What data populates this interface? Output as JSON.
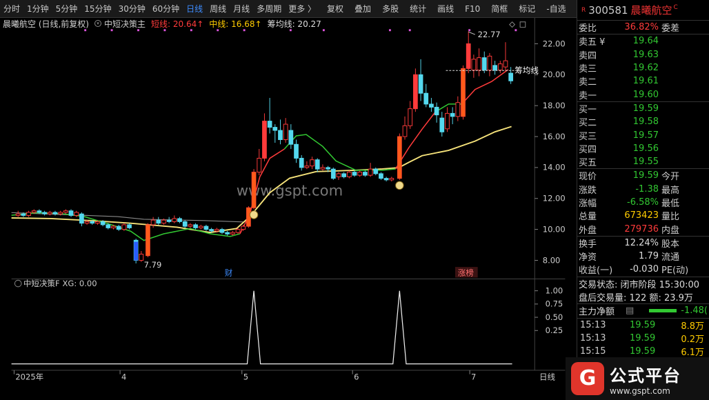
{
  "toolbar": {
    "periods": [
      "分时",
      "1分钟",
      "5分钟",
      "15分钟",
      "30分钟",
      "60分钟",
      "日线",
      "周线",
      "月线",
      "多周期",
      "更多 〉"
    ],
    "active": "日线",
    "tools": [
      "复权",
      "叠加",
      "多股",
      "统计",
      "画线",
      "F10",
      "简框",
      "标记",
      "-自选",
      "返回"
    ]
  },
  "chart_header": {
    "title": "晨曦航空 (日线,前复权)",
    "indicator": "中短决策主",
    "short_label": "短线: 20.64↑",
    "mid_label": "中线: 16.68↑",
    "chip_label": "筹均线: 20.27"
  },
  "annotations": {
    "high_label": "22.77",
    "low_label": "7.79",
    "chip_tag": "筹均线",
    "cai_tag": "财",
    "zhangbang_tag": "涨榜",
    "watermark": "www.gspt.com"
  },
  "price_axis": [
    "22.00",
    "20.00",
    "18.00",
    "16.00",
    "14.00",
    "12.00",
    "10.00",
    "8.00"
  ],
  "sub_header": {
    "name": "中短决策F",
    "xg": "XG: 0.00"
  },
  "sub_axis": [
    "1.00",
    "0.75",
    "0.50",
    "0.25"
  ],
  "date_axis": [
    "2025年",
    "4",
    "5",
    "6",
    "7"
  ],
  "date_axis_right": "日线",
  "quote": {
    "code": "300581",
    "name": "晨曦航空",
    "r_mark": "R",
    "c_mark": "C",
    "weibi": {
      "label": "委比",
      "value": "36.82%",
      "label2": "委差"
    },
    "asks": [
      {
        "label": "卖五 ¥",
        "price": "19.64"
      },
      {
        "label": "卖四",
        "price": "19.63"
      },
      {
        "label": "卖三",
        "price": "19.62"
      },
      {
        "label": "卖二",
        "price": "19.61"
      },
      {
        "label": "卖一",
        "price": "19.60"
      }
    ],
    "bids": [
      {
        "label": "买一",
        "price": "19.59"
      },
      {
        "label": "买二",
        "price": "19.58"
      },
      {
        "label": "买三",
        "price": "19.57"
      },
      {
        "label": "买四",
        "price": "19.56"
      },
      {
        "label": "买五",
        "price": "19.55"
      }
    ],
    "stats": [
      {
        "k": "现价",
        "v": "19.59",
        "c": "green",
        "k2": "今开"
      },
      {
        "k": "涨跌",
        "v": "-1.38",
        "c": "green",
        "k2": "最高"
      },
      {
        "k": "涨幅",
        "v": "-6.58%",
        "c": "green",
        "k2": "最低"
      },
      {
        "k": "总量",
        "v": "673423",
        "c": "yellow",
        "k2": "量比"
      },
      {
        "k": "外盘",
        "v": "279736",
        "c": "red",
        "k2": "内盘"
      }
    ],
    "stats2": [
      {
        "k": "换手",
        "v": "12.24%",
        "c": "white",
        "k2": "股本"
      },
      {
        "k": "净资",
        "v": "1.79",
        "c": "white",
        "k2": "流通"
      },
      {
        "k": "收益(一)",
        "v": "-0.030",
        "c": "white",
        "k2": "PE(动)"
      }
    ],
    "trade_status": "交易状态: 闭市阶段 15:30:00",
    "after_hours": "盘后交易量: 122  额: 23.9万",
    "net_inflow": {
      "label": "主力净额",
      "value": "-1.48("
    },
    "ticks": [
      {
        "t": "15:13",
        "p": "19.59",
        "v": "8.8万"
      },
      {
        "t": "15:13",
        "p": "19.59",
        "v": "0.2万"
      },
      {
        "t": "15:15",
        "p": "19.59",
        "v": "6.1万"
      }
    ]
  },
  "logo": {
    "brand": "公式平台",
    "url": "www.gspt.com",
    "icon": "G"
  }
}
